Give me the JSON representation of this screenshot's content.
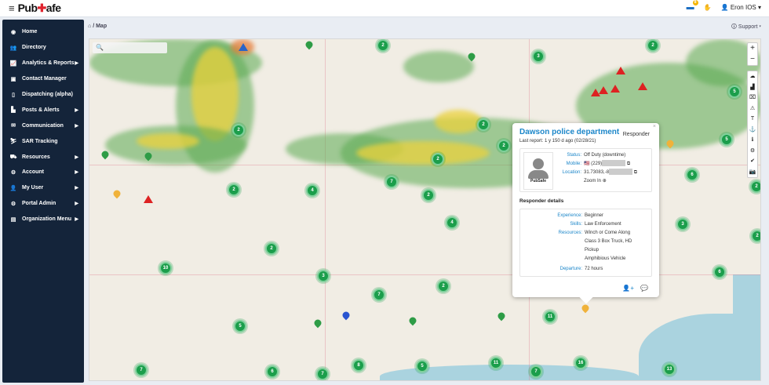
{
  "header": {
    "logo": "PubSafe",
    "logo_pre": "Pub",
    "logo_post": "afe",
    "notif_count": "8",
    "user": "Eron IOS"
  },
  "sidebar": {
    "items": [
      {
        "label": "Home",
        "icon": "globe"
      },
      {
        "label": "Directory",
        "icon": "users"
      },
      {
        "label": "Analytics & Reports",
        "icon": "chart",
        "sub": true
      },
      {
        "label": "Contact Manager",
        "icon": "address-book"
      },
      {
        "label": "Dispatching (alpha)",
        "icon": "mobile"
      },
      {
        "label": "Posts & Alerts",
        "icon": "building",
        "sub": true
      },
      {
        "label": "Communication",
        "icon": "envelope",
        "sub": true
      },
      {
        "label": "SAR Tracking",
        "icon": "tracking"
      },
      {
        "label": "Resources",
        "icon": "truck",
        "sub": true
      },
      {
        "label": "Account",
        "icon": "cog",
        "sub": true
      },
      {
        "label": "My User",
        "icon": "user",
        "sub": true
      },
      {
        "label": "Portal Admin",
        "icon": "cog",
        "sub": true
      },
      {
        "label": "Organization Menu",
        "icon": "book",
        "sub": true
      }
    ]
  },
  "breadcrumb": {
    "home": "⌂",
    "sep": "/",
    "current": "Map"
  },
  "support": "Support",
  "map": {
    "clusters": [
      "2",
      "3",
      "2",
      "5",
      "2",
      "2",
      "2",
      "2",
      "7",
      "4",
      "2",
      "2",
      "4",
      "2",
      "10",
      "3",
      "2",
      "7",
      "11",
      "5",
      "7",
      "6",
      "7",
      "8",
      "5",
      "11",
      "7",
      "16",
      "13",
      "6",
      "3",
      "6",
      "2",
      "2",
      "5"
    ],
    "zoom_in": "+",
    "zoom_out": "−"
  },
  "popup": {
    "title": "Dawson police department",
    "role": "Responder",
    "last_report": "Last report:  1 y 150 d ago (02/28/21)",
    "status_label": "Status:",
    "status": "Off Duty (downtime)",
    "mobile_label": "Mobile:",
    "mobile": "(229)",
    "location_label": "Location:",
    "location": "31.73083,-8",
    "zoom_in": "Zoom In",
    "section": "Responder details",
    "experience_label": "Experience:",
    "experience": "Beginner",
    "skills_label": "Skills:",
    "skills": "Law Enforcement",
    "resources_label": "Resources:",
    "resources": [
      "Winch or Come Along",
      "Class 3 Box Truck, HD",
      "Pickup",
      "Amphibious Vehicle"
    ],
    "departure_label": "Departure:",
    "departure": "72 hours",
    "logo": "PubSafe"
  }
}
